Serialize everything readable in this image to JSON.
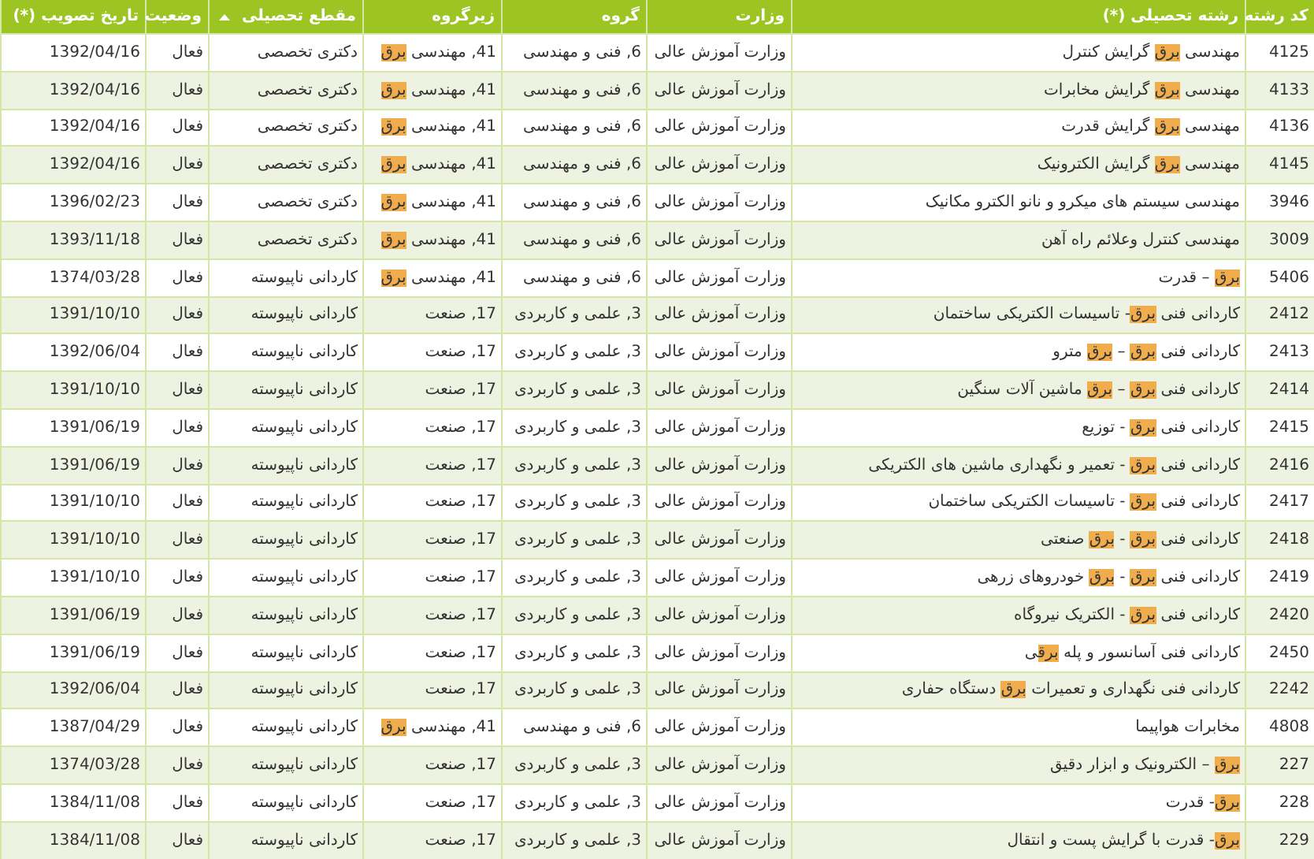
{
  "table": {
    "columns": [
      {
        "label": "کد رشته",
        "sorted": false
      },
      {
        "label": "رشته تحصیلی (*)",
        "sorted": false
      },
      {
        "label": "وزارت",
        "sorted": false
      },
      {
        "label": "گروه",
        "sorted": false
      },
      {
        "label": "زیرگروه",
        "sorted": false
      },
      {
        "label": "مقطع تحصیلی",
        "sorted": true
      },
      {
        "label": "وضعیت",
        "sorted": false
      },
      {
        "label": "تاریخ تصویب (*)",
        "sorted": false
      }
    ],
    "rows": [
      {
        "code": "4125",
        "name": [
          {
            "text": "مهندسی ",
            "highlighted": false
          },
          {
            "text": "برق",
            "highlighted": true
          },
          {
            "text": " گرایش کنترل",
            "highlighted": false
          }
        ],
        "ministry": "وزارت آموزش عالی",
        "group": "6, فنی و مهندسی",
        "subgroup": [
          {
            "text": "41, مهندسی ",
            "highlighted": false
          },
          {
            "text": "برق",
            "highlighted": true
          }
        ],
        "level": "دکتری تخصصی",
        "status": "فعال",
        "date": "1392/04/16"
      },
      {
        "code": "4133",
        "name": [
          {
            "text": "مهندسی ",
            "highlighted": false
          },
          {
            "text": "برق",
            "highlighted": true
          },
          {
            "text": " گرایش مخابرات",
            "highlighted": false
          }
        ],
        "ministry": "وزارت آموزش عالی",
        "group": "6, فنی و مهندسی",
        "subgroup": [
          {
            "text": "41, مهندسی ",
            "highlighted": false
          },
          {
            "text": "برق",
            "highlighted": true
          }
        ],
        "level": "دکتری تخصصی",
        "status": "فعال",
        "date": "1392/04/16"
      },
      {
        "code": "4136",
        "name": [
          {
            "text": "مهندسی ",
            "highlighted": false
          },
          {
            "text": "برق",
            "highlighted": true
          },
          {
            "text": " گرایش قدرت",
            "highlighted": false
          }
        ],
        "ministry": "وزارت آموزش عالی",
        "group": "6, فنی و مهندسی",
        "subgroup": [
          {
            "text": "41, مهندسی ",
            "highlighted": false
          },
          {
            "text": "برق",
            "highlighted": true
          }
        ],
        "level": "دکتری تخصصی",
        "status": "فعال",
        "date": "1392/04/16"
      },
      {
        "code": "4145",
        "name": [
          {
            "text": "مهندسی ",
            "highlighted": false
          },
          {
            "text": "برق",
            "highlighted": true
          },
          {
            "text": " گرایش الکترونیک",
            "highlighted": false
          }
        ],
        "ministry": "وزارت آموزش عالی",
        "group": "6, فنی و مهندسی",
        "subgroup": [
          {
            "text": "41, مهندسی ",
            "highlighted": false
          },
          {
            "text": "برق",
            "highlighted": true
          }
        ],
        "level": "دکتری تخصصی",
        "status": "فعال",
        "date": "1392/04/16"
      },
      {
        "code": "3946",
        "name": [
          {
            "text": "مهندسی سیستم های میکرو و نانو الکترو مکانیک",
            "highlighted": false
          }
        ],
        "ministry": "وزارت آموزش عالی",
        "group": "6, فنی و مهندسی",
        "subgroup": [
          {
            "text": "41, مهندسی ",
            "highlighted": false
          },
          {
            "text": "برق",
            "highlighted": true
          }
        ],
        "level": "دکتری تخصصی",
        "status": "فعال",
        "date": "1396/02/23"
      },
      {
        "code": "3009",
        "name": [
          {
            "text": "مهندسی کنترل وعلائم راه آهن",
            "highlighted": false
          }
        ],
        "ministry": "وزارت آموزش عالی",
        "group": "6, فنی و مهندسی",
        "subgroup": [
          {
            "text": "41, مهندسی ",
            "highlighted": false
          },
          {
            "text": "برق",
            "highlighted": true
          }
        ],
        "level": "دکتری تخصصی",
        "status": "فعال",
        "date": "1393/11/18"
      },
      {
        "code": "5406",
        "name": [
          {
            "text": "برق",
            "highlighted": true
          },
          {
            "text": " – قدرت",
            "highlighted": false
          }
        ],
        "ministry": "وزارت آموزش عالی",
        "group": "6, فنی و مهندسی",
        "subgroup": [
          {
            "text": "41, مهندسی ",
            "highlighted": false
          },
          {
            "text": "برق",
            "highlighted": true
          }
        ],
        "level": "کاردانی ناپیوسته",
        "status": "فعال",
        "date": "1374/03/28"
      },
      {
        "code": "2412",
        "name": [
          {
            "text": "کاردانی فنی ",
            "highlighted": false
          },
          {
            "text": "برق",
            "highlighted": true
          },
          {
            "text": "- تاسیسات الکتریکی ساختمان",
            "highlighted": false
          }
        ],
        "ministry": "وزارت آموزش عالی",
        "group": "3, علمی و کاربردی",
        "subgroup": [
          {
            "text": "17, صنعت",
            "highlighted": false
          }
        ],
        "level": "کاردانی ناپیوسته",
        "status": "فعال",
        "date": "1391/10/10"
      },
      {
        "code": "2413",
        "name": [
          {
            "text": "کاردانی فنی ",
            "highlighted": false
          },
          {
            "text": "برق",
            "highlighted": true
          },
          {
            "text": " – ",
            "highlighted": false
          },
          {
            "text": "برق",
            "highlighted": true
          },
          {
            "text": " مترو",
            "highlighted": false
          }
        ],
        "ministry": "وزارت آموزش عالی",
        "group": "3, علمی و کاربردی",
        "subgroup": [
          {
            "text": "17, صنعت",
            "highlighted": false
          }
        ],
        "level": "کاردانی ناپیوسته",
        "status": "فعال",
        "date": "1392/06/04"
      },
      {
        "code": "2414",
        "name": [
          {
            "text": "کاردانی فنی ",
            "highlighted": false
          },
          {
            "text": "برق",
            "highlighted": true
          },
          {
            "text": " – ",
            "highlighted": false
          },
          {
            "text": "برق",
            "highlighted": true
          },
          {
            "text": " ماشین آلات سنگین",
            "highlighted": false
          }
        ],
        "ministry": "وزارت آموزش عالی",
        "group": "3, علمی و کاربردی",
        "subgroup": [
          {
            "text": "17, صنعت",
            "highlighted": false
          }
        ],
        "level": "کاردانی ناپیوسته",
        "status": "فعال",
        "date": "1391/10/10"
      },
      {
        "code": "2415",
        "name": [
          {
            "text": "کاردانی فنی ",
            "highlighted": false
          },
          {
            "text": "برق",
            "highlighted": true
          },
          {
            "text": " - توزیع",
            "highlighted": false
          }
        ],
        "ministry": "وزارت آموزش عالی",
        "group": "3, علمی و کاربردی",
        "subgroup": [
          {
            "text": "17, صنعت",
            "highlighted": false
          }
        ],
        "level": "کاردانی ناپیوسته",
        "status": "فعال",
        "date": "1391/06/19"
      },
      {
        "code": "2416",
        "name": [
          {
            "text": "کاردانی فنی ",
            "highlighted": false
          },
          {
            "text": "برق",
            "highlighted": true
          },
          {
            "text": " - تعمیر و نگهداری ماشین های الکتریکی",
            "highlighted": false
          }
        ],
        "ministry": "وزارت آموزش عالی",
        "group": "3, علمی و کاربردی",
        "subgroup": [
          {
            "text": "17, صنعت",
            "highlighted": false
          }
        ],
        "level": "کاردانی ناپیوسته",
        "status": "فعال",
        "date": "1391/06/19"
      },
      {
        "code": "2417",
        "name": [
          {
            "text": "کاردانی فنی ",
            "highlighted": false
          },
          {
            "text": "برق",
            "highlighted": true
          },
          {
            "text": " - تاسیسات الکتریکی ساختمان",
            "highlighted": false
          }
        ],
        "ministry": "وزارت آموزش عالی",
        "group": "3, علمی و کاربردی",
        "subgroup": [
          {
            "text": "17, صنعت",
            "highlighted": false
          }
        ],
        "level": "کاردانی ناپیوسته",
        "status": "فعال",
        "date": "1391/10/10"
      },
      {
        "code": "2418",
        "name": [
          {
            "text": "کاردانی فنی ",
            "highlighted": false
          },
          {
            "text": "برق",
            "highlighted": true
          },
          {
            "text": " - ",
            "highlighted": false
          },
          {
            "text": "برق",
            "highlighted": true
          },
          {
            "text": " صنعتی",
            "highlighted": false
          }
        ],
        "ministry": "وزارت آموزش عالی",
        "group": "3, علمی و کاربردی",
        "subgroup": [
          {
            "text": "17, صنعت",
            "highlighted": false
          }
        ],
        "level": "کاردانی ناپیوسته",
        "status": "فعال",
        "date": "1391/10/10"
      },
      {
        "code": "2419",
        "name": [
          {
            "text": "کاردانی فنی ",
            "highlighted": false
          },
          {
            "text": "برق",
            "highlighted": true
          },
          {
            "text": " - ",
            "highlighted": false
          },
          {
            "text": "برق",
            "highlighted": true
          },
          {
            "text": " خودروهای زرهی",
            "highlighted": false
          }
        ],
        "ministry": "وزارت آموزش عالی",
        "group": "3, علمی و کاربردی",
        "subgroup": [
          {
            "text": "17, صنعت",
            "highlighted": false
          }
        ],
        "level": "کاردانی ناپیوسته",
        "status": "فعال",
        "date": "1391/10/10"
      },
      {
        "code": "2420",
        "name": [
          {
            "text": "کاردانی فنی ",
            "highlighted": false
          },
          {
            "text": "برق",
            "highlighted": true
          },
          {
            "text": " - الکتریک نیروگاه",
            "highlighted": false
          }
        ],
        "ministry": "وزارت آموزش عالی",
        "group": "3, علمی و کاربردی",
        "subgroup": [
          {
            "text": "17, صنعت",
            "highlighted": false
          }
        ],
        "level": "کاردانی ناپیوسته",
        "status": "فعال",
        "date": "1391/06/19"
      },
      {
        "code": "2450",
        "name": [
          {
            "text": "کاردانی فنی آسانسور و پله ",
            "highlighted": false
          },
          {
            "text": "برق",
            "highlighted": true
          },
          {
            "text": "ی",
            "highlighted": false
          }
        ],
        "ministry": "وزارت آموزش عالی",
        "group": "3, علمی و کاربردی",
        "subgroup": [
          {
            "text": "17, صنعت",
            "highlighted": false
          }
        ],
        "level": "کاردانی ناپیوسته",
        "status": "فعال",
        "date": "1391/06/19"
      },
      {
        "code": "2242",
        "name": [
          {
            "text": "کاردانی فنی نگهداری و تعمیرات ",
            "highlighted": false
          },
          {
            "text": "برق",
            "highlighted": true
          },
          {
            "text": " دستگاه حفاری",
            "highlighted": false
          }
        ],
        "ministry": "وزارت آموزش عالی",
        "group": "3, علمی و کاربردی",
        "subgroup": [
          {
            "text": "17, صنعت",
            "highlighted": false
          }
        ],
        "level": "کاردانی ناپیوسته",
        "status": "فعال",
        "date": "1392/06/04"
      },
      {
        "code": "4808",
        "name": [
          {
            "text": "مخابرات هواپیما",
            "highlighted": false
          }
        ],
        "ministry": "وزارت آموزش عالی",
        "group": "6, فنی و مهندسی",
        "subgroup": [
          {
            "text": "41, مهندسی ",
            "highlighted": false
          },
          {
            "text": "برق",
            "highlighted": true
          }
        ],
        "level": "کاردانی ناپیوسته",
        "status": "فعال",
        "date": "1387/04/29"
      },
      {
        "code": "227",
        "name": [
          {
            "text": "برق",
            "highlighted": true
          },
          {
            "text": " – الکترونیک و ابزار دقیق",
            "highlighted": false
          }
        ],
        "ministry": "وزارت آموزش عالی",
        "group": "3, علمی و کاربردی",
        "subgroup": [
          {
            "text": "17, صنعت",
            "highlighted": false
          }
        ],
        "level": "کاردانی ناپیوسته",
        "status": "فعال",
        "date": "1374/03/28"
      },
      {
        "code": "228",
        "name": [
          {
            "text": "برق",
            "highlighted": true
          },
          {
            "text": "- قدرت",
            "highlighted": false
          }
        ],
        "ministry": "وزارت آموزش عالی",
        "group": "3, علمی و کاربردی",
        "subgroup": [
          {
            "text": "17, صنعت",
            "highlighted": false
          }
        ],
        "level": "کاردانی ناپیوسته",
        "status": "فعال",
        "date": "1384/11/08"
      },
      {
        "code": "229",
        "name": [
          {
            "text": "برق",
            "highlighted": true
          },
          {
            "text": "- قدرت با گرایش پست و انتقال",
            "highlighted": false
          }
        ],
        "ministry": "وزارت آموزش عالی",
        "group": "3, علمی و کاربردی",
        "subgroup": [
          {
            "text": "17, صنعت",
            "highlighted": false
          }
        ],
        "level": "کاردانی ناپیوسته",
        "status": "فعال",
        "date": "1384/11/08"
      }
    ]
  }
}
